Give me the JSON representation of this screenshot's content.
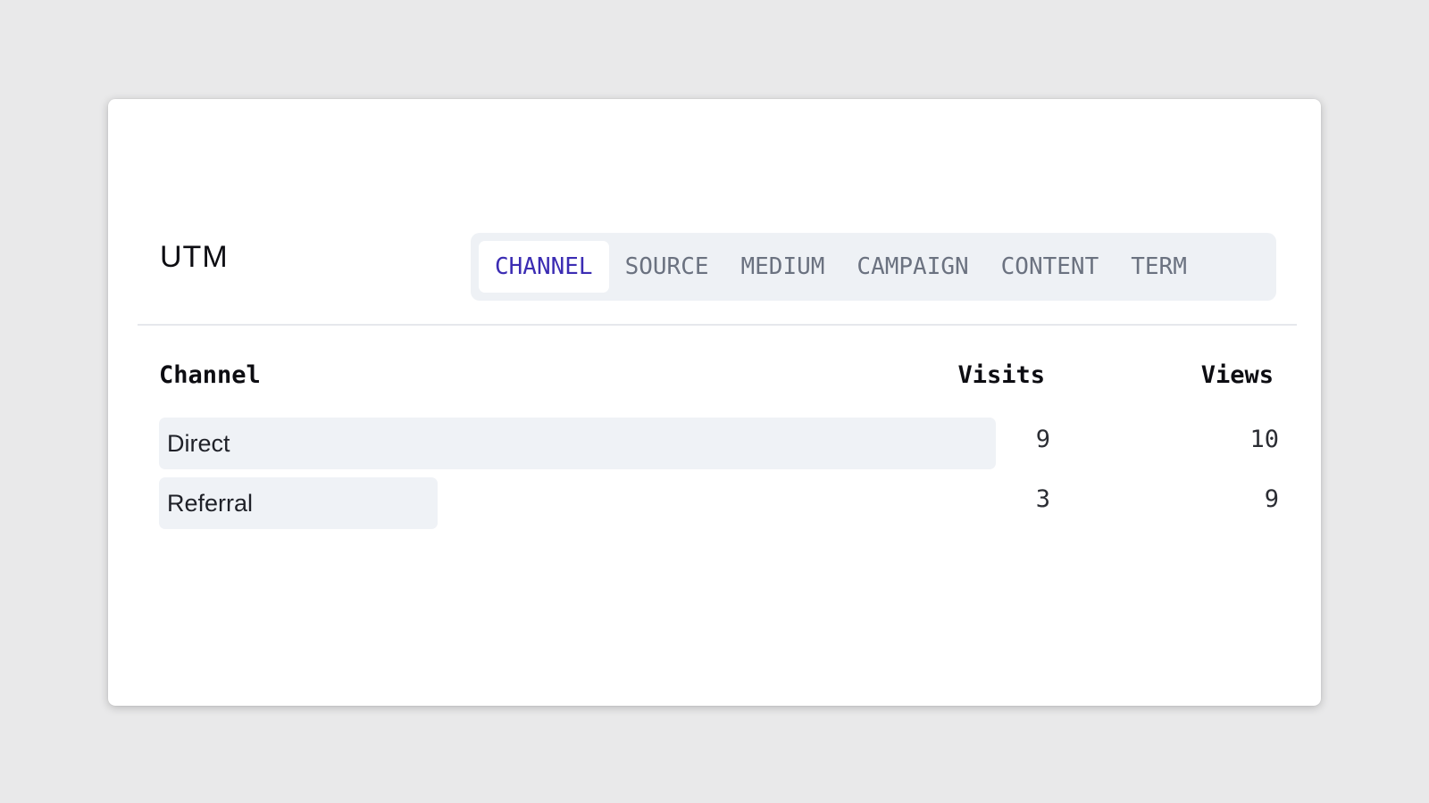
{
  "card": {
    "title": "UTM"
  },
  "tabs": [
    {
      "label": "CHANNEL",
      "active": true
    },
    {
      "label": "SOURCE",
      "active": false
    },
    {
      "label": "MEDIUM",
      "active": false
    },
    {
      "label": "CAMPAIGN",
      "active": false
    },
    {
      "label": "CONTENT",
      "active": false
    },
    {
      "label": "TERM",
      "active": false
    }
  ],
  "table": {
    "headers": {
      "channel": "Channel",
      "visits": "Visits",
      "views": "Views"
    },
    "rows": [
      {
        "channel": "Direct",
        "visits": "9",
        "views": "10",
        "bar_fraction": 1.0
      },
      {
        "channel": "Referral",
        "visits": "3",
        "views": "9",
        "bar_fraction": 0.333
      }
    ]
  },
  "colors": {
    "active_tab_text": "#3b2cb3",
    "inactive_tab_text": "#6b7280",
    "tab_bar_background": "#eef1f5",
    "row_bar": "#eff2f6"
  }
}
